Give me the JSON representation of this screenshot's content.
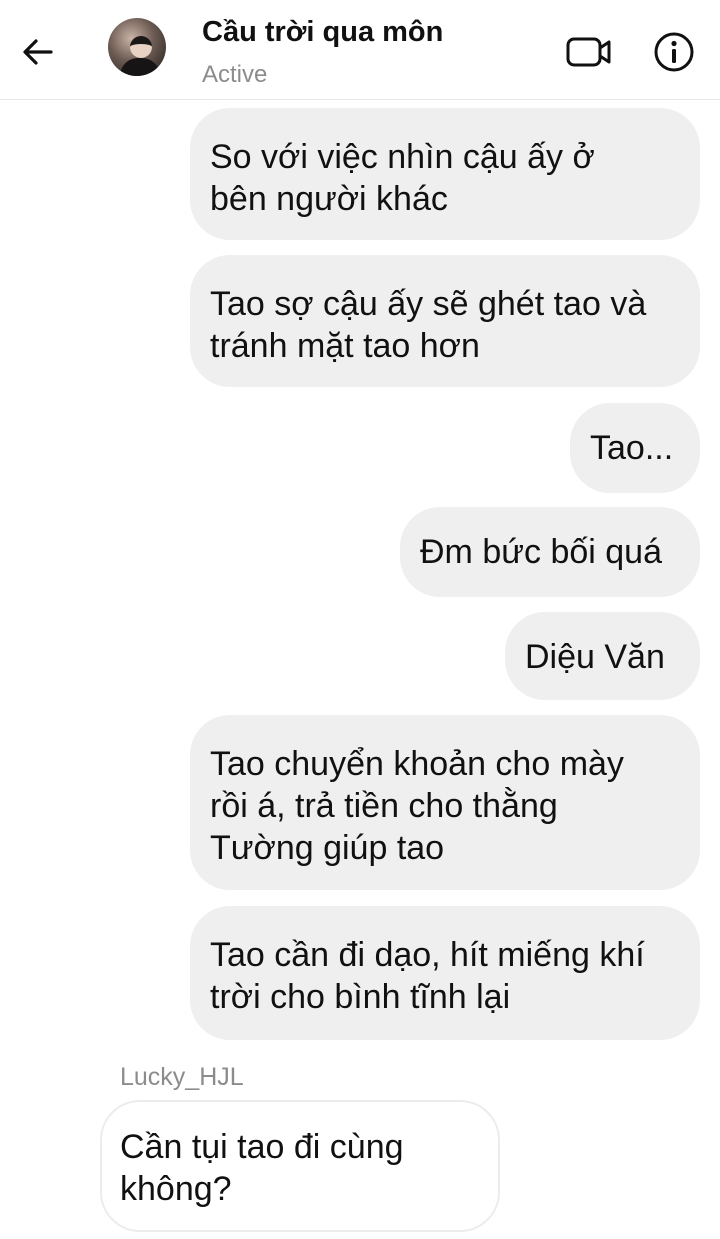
{
  "header": {
    "title": "Cầu trời qua môn",
    "status": "Active",
    "back_icon": "arrow-left-icon",
    "video_icon": "video-camera-icon",
    "info_icon": "info-circle-icon"
  },
  "messages": [
    {
      "direction": "outgoing",
      "text": "So với việc nhìn cậu ấy ở\nbên người khác"
    },
    {
      "direction": "outgoing",
      "text": "Tao sợ cậu ấy sẽ ghét tao và\ntránh mặt tao hơn"
    },
    {
      "direction": "outgoing",
      "text": "Tao..."
    },
    {
      "direction": "outgoing",
      "text": "Đm bức bối quá"
    },
    {
      "direction": "outgoing",
      "text": "Diệu Văn"
    },
    {
      "direction": "outgoing",
      "text": "Tao chuyển khoản cho mày\nrồi á, trả tiền cho thằng\nTường giúp tao"
    },
    {
      "direction": "outgoing",
      "text": "Tao cần đi dạo, hít miếng khí\ntrời cho bình tĩnh lại"
    },
    {
      "direction": "incoming",
      "sender": "Lucky_HJL",
      "text": "Cần tụi tao đi cùng\nkhông?"
    }
  ],
  "colors": {
    "outgoing_bubble": "#efefef",
    "incoming_bubble": "#ffffff",
    "secondary_text": "#8c8c8c"
  }
}
